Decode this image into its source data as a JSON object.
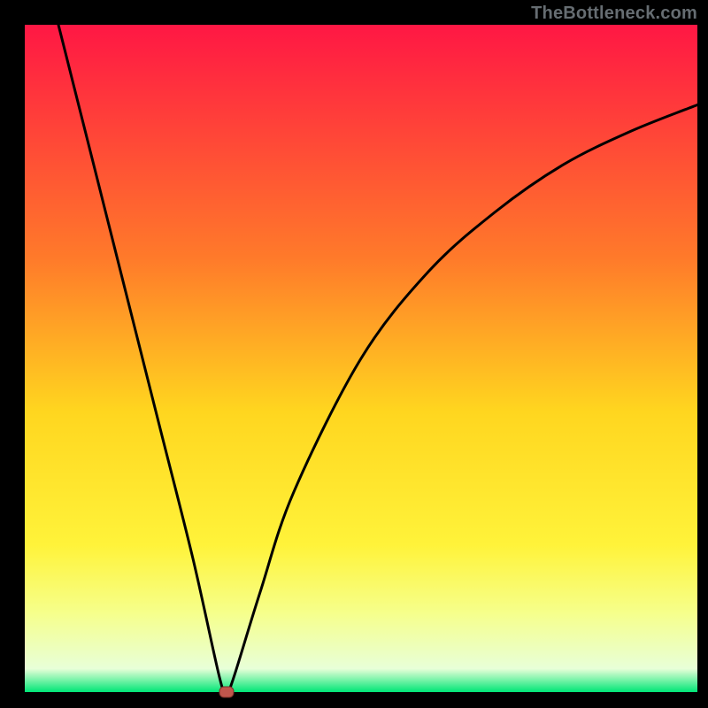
{
  "watermark": "TheBottleneck.com",
  "chart_data": {
    "type": "line",
    "title": "",
    "xlabel": "",
    "ylabel": "",
    "xlim": [
      0,
      100
    ],
    "ylim": [
      0,
      100
    ],
    "curve": {
      "name": "bottleneck-curve",
      "x": [
        5,
        10,
        15,
        20,
        25,
        29,
        30,
        31,
        35,
        40,
        50,
        60,
        70,
        80,
        90,
        100
      ],
      "y": [
        100,
        80,
        60,
        40,
        20,
        2,
        0,
        2,
        15,
        30,
        50,
        63,
        72,
        79,
        84,
        88
      ]
    },
    "marker": {
      "name": "optimal-point",
      "x": 30,
      "y": 0,
      "color": "#c0564c"
    },
    "gradient_stops": [
      {
        "offset": 0.0,
        "color": "#ff1744"
      },
      {
        "offset": 0.35,
        "color": "#ff7a2a"
      },
      {
        "offset": 0.58,
        "color": "#ffd61f"
      },
      {
        "offset": 0.78,
        "color": "#fff33a"
      },
      {
        "offset": 0.88,
        "color": "#f6ff8a"
      },
      {
        "offset": 0.965,
        "color": "#e8ffd8"
      },
      {
        "offset": 1.0,
        "color": "#00e676"
      }
    ]
  },
  "colors": {
    "frame": "#000000",
    "curve": "#000000",
    "marker_fill": "#c0564c",
    "marker_stroke": "#7a2f28"
  }
}
